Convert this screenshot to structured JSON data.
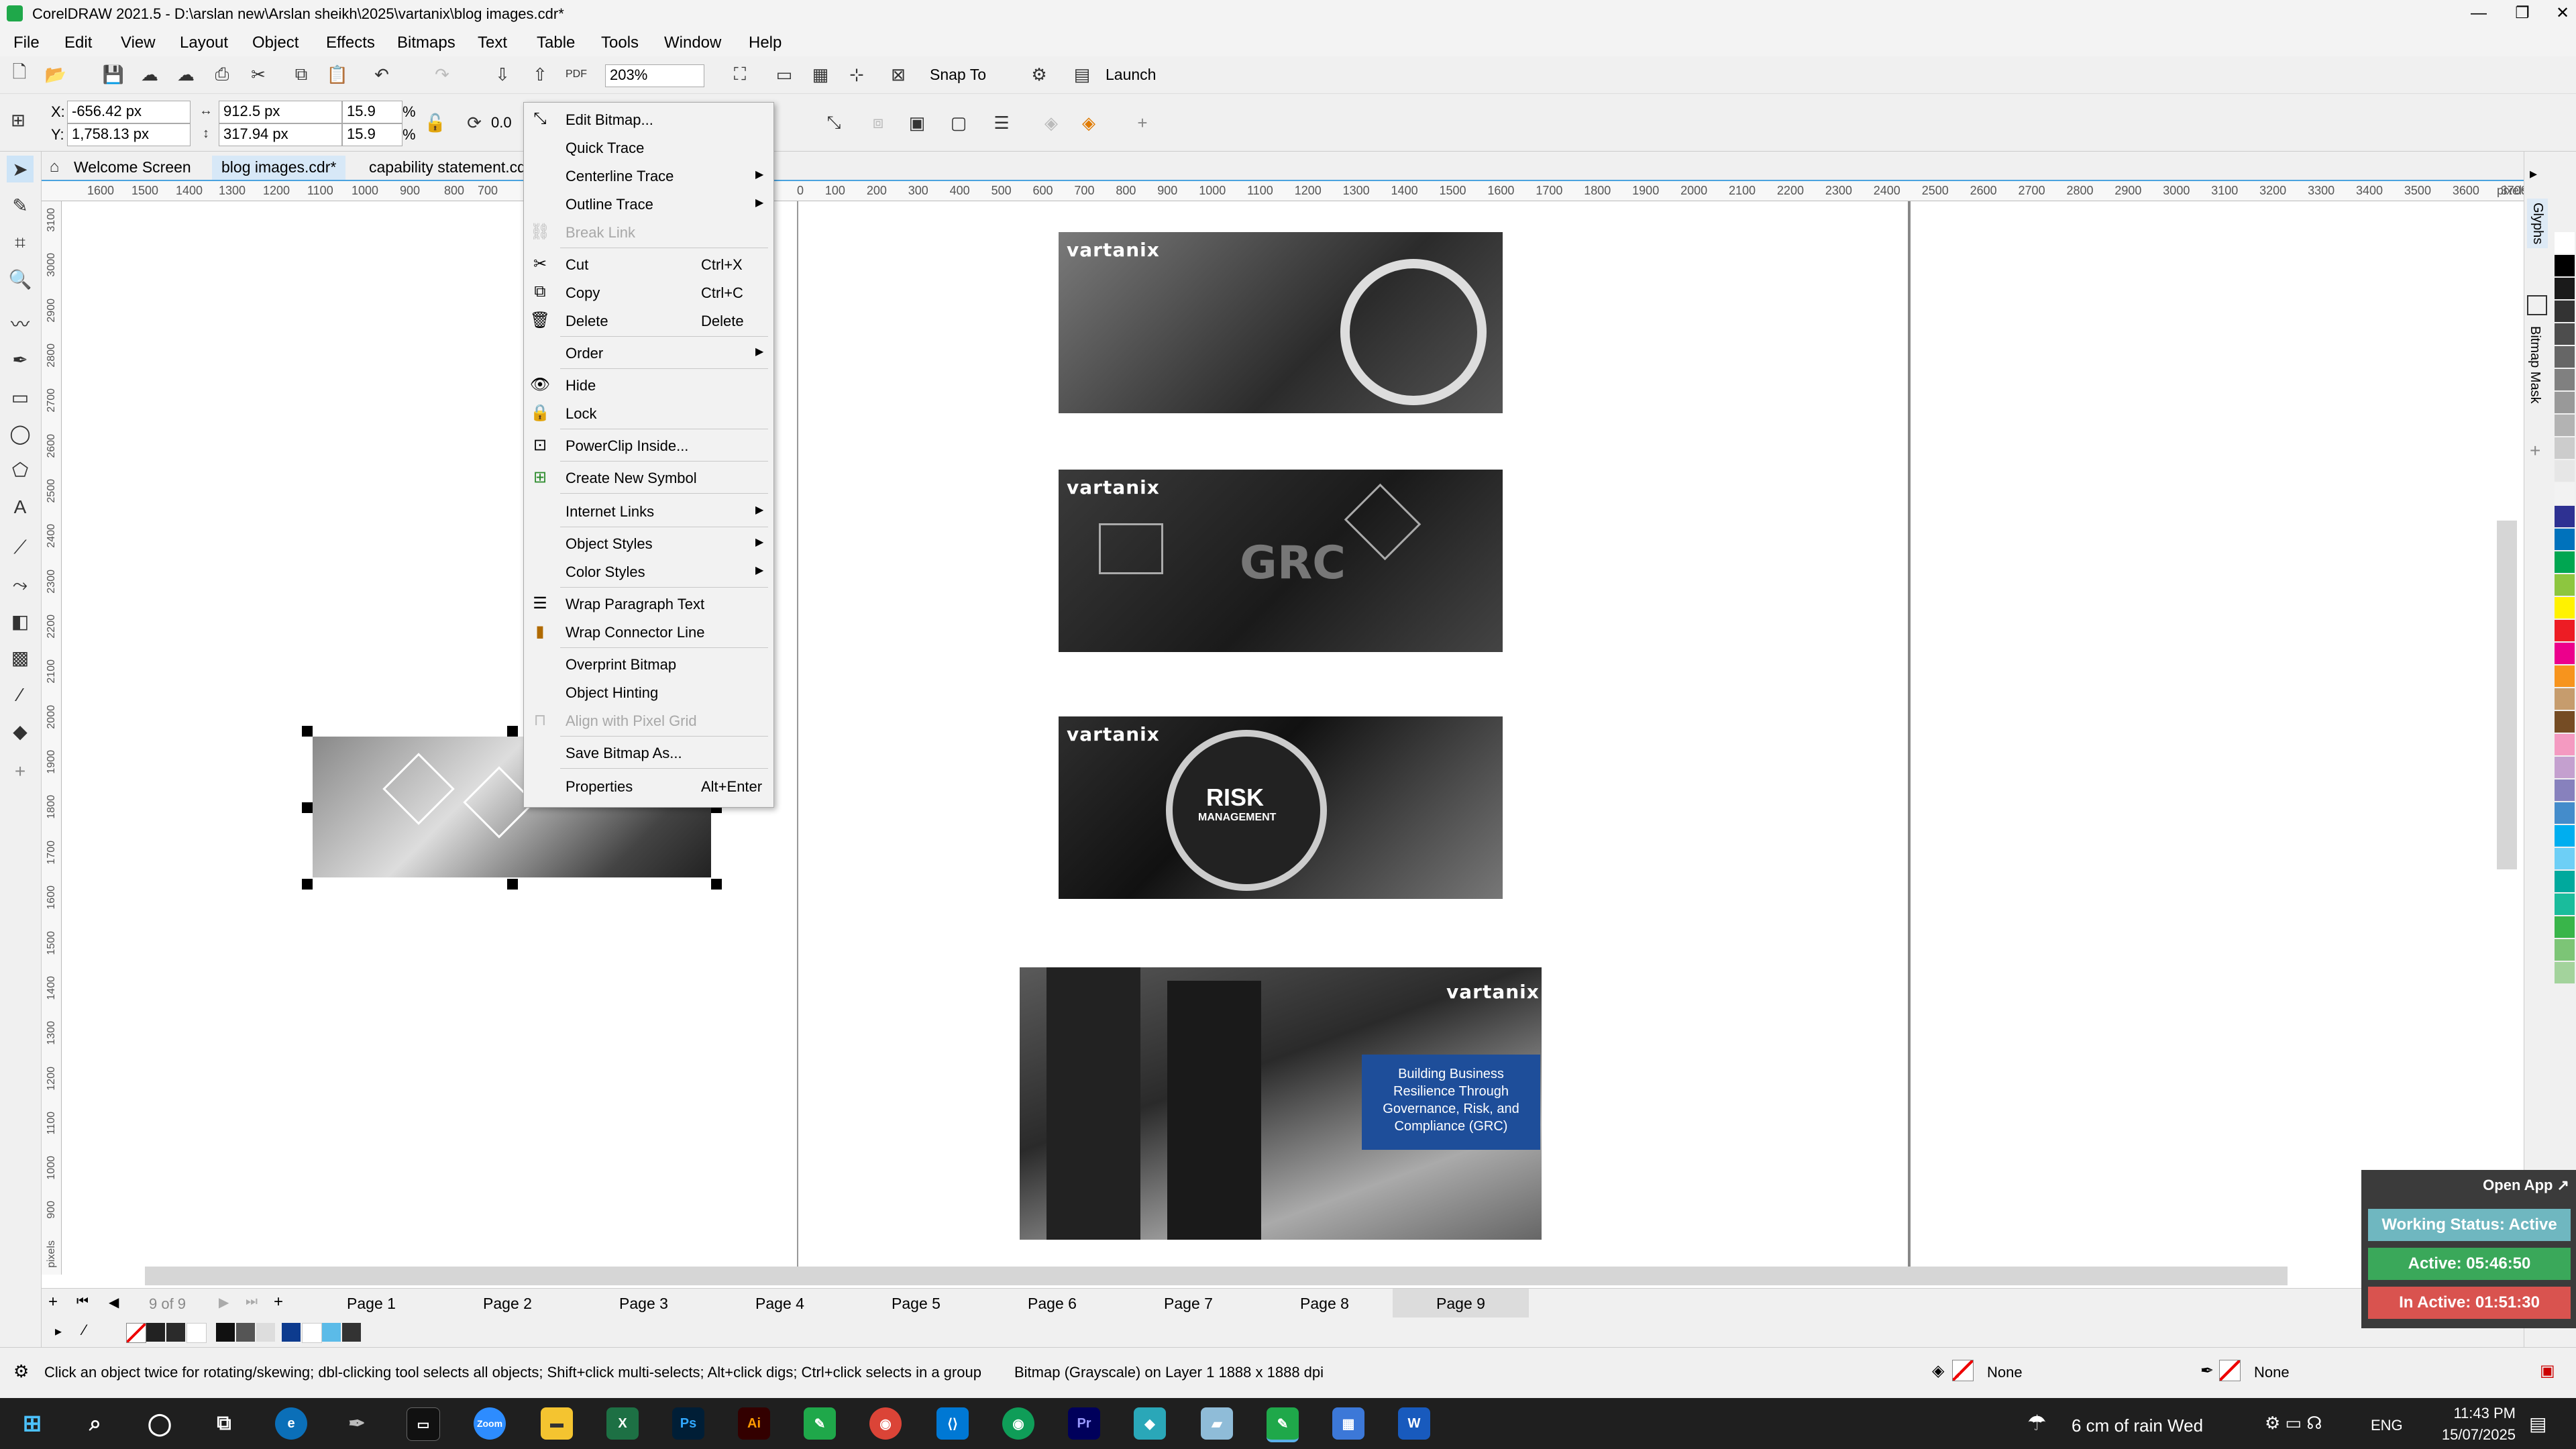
{
  "window": {
    "title": "CorelDRAW 2021.5 - D:\\arslan new\\Arslan sheikh\\2025\\vartanix\\blog images.cdr*",
    "minimize": "—",
    "maximize": "❐",
    "close": "✕"
  },
  "menu": [
    "File",
    "Edit",
    "View",
    "Layout",
    "Object",
    "Effects",
    "Bitmaps",
    "Text",
    "Table",
    "Tools",
    "Window",
    "Help"
  ],
  "toolbar": {
    "zoom_value": "203%",
    "snap_to": "Snap To",
    "launch": "Launch"
  },
  "property_bar": {
    "x": "-656.42 px",
    "y": "1,758.13 px",
    "width": "912.5 px",
    "height": "317.94 px",
    "scale_x": "15.9",
    "scale_y": "15.9",
    "percent": "%",
    "rotation": "0.0",
    "x_label": "X:",
    "y_label": "Y:"
  },
  "doc_tabs": [
    "Welcome Screen",
    "blog images.cdr*",
    "capability statement.cdr"
  ],
  "ruler": {
    "h_ticks_left": [
      "1600",
      "1500",
      "1400",
      "1300",
      "1200",
      "1100",
      "1000",
      "900",
      "800",
      "700"
    ],
    "h_ticks_right": [
      "0",
      "100",
      "200",
      "300",
      "400",
      "500",
      "600",
      "700",
      "800",
      "900",
      "1000",
      "1100",
      "1200",
      "1300",
      "1400",
      "1500",
      "1600",
      "1700",
      "1800",
      "1900",
      "2000",
      "2100",
      "2200",
      "2300",
      "2400",
      "2500",
      "2600",
      "2700",
      "2800",
      "2900",
      "3000",
      "3100",
      "3200",
      "3300",
      "3400",
      "3500",
      "3600",
      "3700"
    ],
    "v_ticks": [
      "3100",
      "3000",
      "2900",
      "2800",
      "2700",
      "2600",
      "2500",
      "2400",
      "2300",
      "2200",
      "2100",
      "2000",
      "1900",
      "1800",
      "1700",
      "1600",
      "1500",
      "1400",
      "1300",
      "1200",
      "1100",
      "1000",
      "900"
    ],
    "unit": "pixels",
    "v_unit": "pixels"
  },
  "context_menu": [
    {
      "label": "Edit Bitmap...",
      "shortcut": "",
      "submenu": false,
      "disabled": false,
      "icon": "edit-bitmap-icon"
    },
    {
      "label": "Quick Trace",
      "shortcut": "",
      "submenu": false,
      "disabled": false,
      "icon": ""
    },
    {
      "label": "Centerline Trace",
      "shortcut": "",
      "submenu": true,
      "disabled": false,
      "icon": ""
    },
    {
      "label": "Outline Trace",
      "shortcut": "",
      "submenu": true,
      "disabled": false,
      "icon": ""
    },
    {
      "label": "Break Link",
      "shortcut": "",
      "submenu": false,
      "disabled": true,
      "icon": "break-link-icon"
    },
    {
      "label": "Cut",
      "shortcut": "Ctrl+X",
      "submenu": false,
      "disabled": false,
      "icon": "cut-icon"
    },
    {
      "label": "Copy",
      "shortcut": "Ctrl+C",
      "submenu": false,
      "disabled": false,
      "icon": "copy-icon"
    },
    {
      "label": "Delete",
      "shortcut": "Delete",
      "submenu": false,
      "disabled": false,
      "icon": "trash-icon"
    },
    {
      "label": "Order",
      "shortcut": "",
      "submenu": true,
      "disabled": false,
      "icon": ""
    },
    {
      "label": "Hide",
      "shortcut": "",
      "submenu": false,
      "disabled": false,
      "icon": "eye-icon"
    },
    {
      "label": "Lock",
      "shortcut": "",
      "submenu": false,
      "disabled": false,
      "icon": "lock-icon"
    },
    {
      "label": "PowerClip Inside...",
      "shortcut": "",
      "submenu": false,
      "disabled": false,
      "icon": "powerclip-icon"
    },
    {
      "label": "Create New Symbol",
      "shortcut": "",
      "submenu": false,
      "disabled": false,
      "icon": "symbol-icon"
    },
    {
      "label": "Internet Links",
      "shortcut": "",
      "submenu": true,
      "disabled": false,
      "icon": ""
    },
    {
      "label": "Object Styles",
      "shortcut": "",
      "submenu": true,
      "disabled": false,
      "icon": ""
    },
    {
      "label": "Color Styles",
      "shortcut": "",
      "submenu": true,
      "disabled": false,
      "icon": ""
    },
    {
      "label": "Wrap Paragraph Text",
      "shortcut": "",
      "submenu": false,
      "disabled": false,
      "icon": "wrap-text-icon"
    },
    {
      "label": "Wrap Connector Line",
      "shortcut": "",
      "submenu": false,
      "disabled": false,
      "icon": "wrap-connector-icon"
    },
    {
      "label": "Overprint Bitmap",
      "shortcut": "",
      "submenu": false,
      "disabled": false,
      "icon": ""
    },
    {
      "label": "Object Hinting",
      "shortcut": "",
      "submenu": false,
      "disabled": false,
      "icon": ""
    },
    {
      "label": "Align with Pixel Grid",
      "shortcut": "",
      "submenu": false,
      "disabled": true,
      "icon": "pixel-grid-icon"
    },
    {
      "label": "Save Bitmap As...",
      "shortcut": "",
      "submenu": false,
      "disabled": false,
      "icon": ""
    },
    {
      "label": "Properties",
      "shortcut": "Alt+Enter",
      "submenu": false,
      "disabled": false,
      "icon": ""
    }
  ],
  "canvas": {
    "brand": "vartanix",
    "risk_title": "RISK",
    "risk_sub": "MANAGEMENT",
    "grc_text": "GRC",
    "banner_text": "Building Business Resilience Through Governance, Risk, and Compliance (GRC)"
  },
  "page_nav": {
    "counter": "9 of 9",
    "pages": [
      "Page 1",
      "Page 2",
      "Page 3",
      "Page 4",
      "Page 5",
      "Page 6",
      "Page 7",
      "Page 8",
      "Page 9"
    ],
    "active_page": "Page 9"
  },
  "status": {
    "hint": "Click an object twice for rotating/skewing; dbl-clicking tool selects all objects; Shift+click multi-selects; Alt+click digs; Ctrl+click selects in a group",
    "object_info": "Bitmap (Grayscale) on Layer 1 1888 x 1888 dpi",
    "fill": "None",
    "outline": "None"
  },
  "right_docker": {
    "tab1": "Glyphs",
    "tab2": "Bitmap Mask"
  },
  "palette_colors": [
    "#ffffff",
    "#000000",
    "#1a1a1a",
    "#333333",
    "#4d4d4d",
    "#666666",
    "#808080",
    "#999999",
    "#b3b3b3",
    "#cccccc",
    "#e6e6e6",
    "#f2f2f2",
    "#2e3192",
    "#0072bc",
    "#00a651",
    "#8dc63f",
    "#fff200",
    "#ed1c24",
    "#ec008c",
    "#f7941d",
    "#c69c6d",
    "#754c24",
    "#f49ac1",
    "#c4a0cf",
    "#8781bd",
    "#448ccb",
    "#00aeef",
    "#6dcff6",
    "#00a99d",
    "#1abc9c",
    "#39b54a",
    "#7cc576",
    "#a3d39c"
  ],
  "tracker": {
    "open_app": "Open App ↗",
    "working_status": "Working Status: Active",
    "active": "Active: 05:46:50",
    "inactive": "In Active: 01:51:30",
    "color_working": "#6fb7c0",
    "color_active": "#3aa85a",
    "color_inactive": "#d9534f"
  },
  "taskbar": {
    "weather": "6 cm of rain Wed",
    "lang": "ENG",
    "time": "11:43 PM",
    "date": "15/07/2025",
    "apps": [
      "Zoom",
      "Ps",
      "Ai",
      "Pr",
      "W"
    ]
  }
}
